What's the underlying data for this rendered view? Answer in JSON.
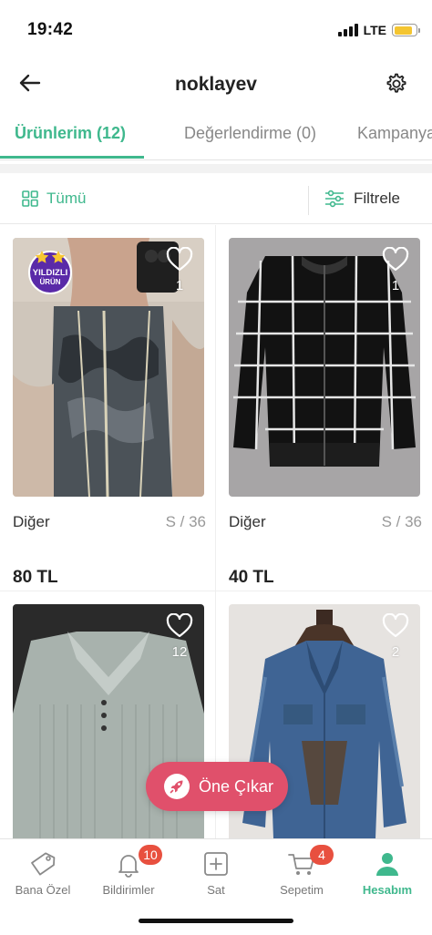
{
  "status_bar": {
    "time": "19:42",
    "network": "LTE",
    "battery_level": 0.85
  },
  "header": {
    "title": "noklayev"
  },
  "tabs": [
    {
      "label": "Ürünlerim (12)",
      "active": true
    },
    {
      "label": "Değerlendirme (0)",
      "active": false
    },
    {
      "label": "Kampanyalar",
      "active": false
    }
  ],
  "filters": {
    "all_label": "Tümü",
    "filter_label": "Filtrele"
  },
  "products": [
    {
      "brand": "Diğer",
      "size": "S / 36",
      "price": "80 TL",
      "likes": "1",
      "badge": {
        "line1": "YILDIZLI",
        "line2": "ÜRÜN"
      }
    },
    {
      "brand": "Diğer",
      "size": "S / 36",
      "price": "40 TL",
      "likes": "1"
    },
    {
      "likes": "12"
    },
    {
      "likes": "2"
    }
  ],
  "promote": {
    "label": "Öne Çıkar"
  },
  "bottom_nav": [
    {
      "label": "Bana Özel",
      "icon": "tag-icon"
    },
    {
      "label": "Bildirimler",
      "icon": "bell-icon",
      "badge": "10"
    },
    {
      "label": "Sat",
      "icon": "plus-square-icon"
    },
    {
      "label": "Sepetim",
      "icon": "cart-icon",
      "badge": "4"
    },
    {
      "label": "Hesabım",
      "icon": "person-icon",
      "active": true
    }
  ],
  "colors": {
    "accent": "#3fb88d",
    "promote": "#e0506b",
    "badge": "#e8503f",
    "badge_purple": "#5a2aa8"
  }
}
